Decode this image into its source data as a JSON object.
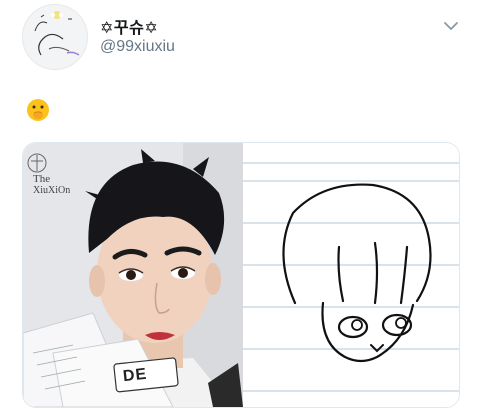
{
  "tweet": {
    "display_name": "✡꾸슈✡",
    "handle": "@99xiuxiu",
    "text_emoji": "🤭",
    "menu_icon": "chevron-down-icon",
    "media": {
      "left_watermark": [
        "The",
        "XiuXiOn"
      ],
      "card_text": "DE"
    }
  },
  "colors": {
    "name": "#14171a",
    "handle": "#657786",
    "border": "#e1e8ed"
  }
}
